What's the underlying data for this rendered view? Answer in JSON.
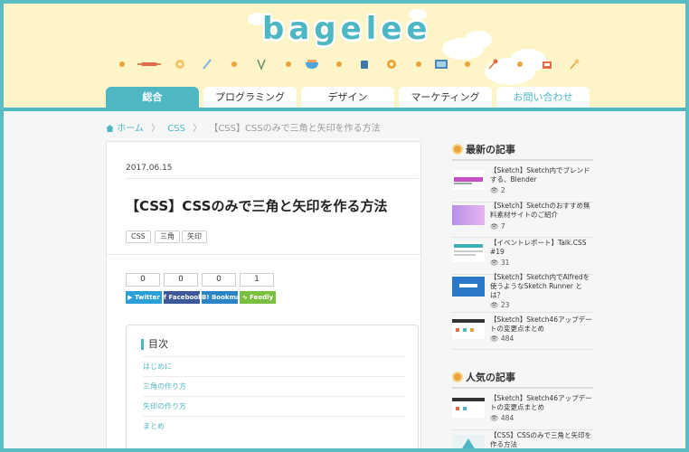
{
  "site": {
    "logo": "bagelee"
  },
  "nav": {
    "tabs": [
      {
        "label": "総合",
        "active": true
      },
      {
        "label": "プログラミング"
      },
      {
        "label": "デザイン"
      },
      {
        "label": "マーケティング"
      },
      {
        "label": "お問い合わせ"
      }
    ]
  },
  "breadcrumb": {
    "home": "ホーム",
    "category": "CSS",
    "current": "【CSS】CSSのみで三角と矢印を作る方法"
  },
  "article": {
    "date": "2017.06.15",
    "title": "【CSS】CSSのみで三角と矢印を作る方法",
    "tags": [
      "CSS",
      "三角",
      "矢印"
    ],
    "share_counts": [
      "0",
      "0",
      "0",
      "1"
    ],
    "share_buttons": [
      "Twitter",
      "Facebook",
      "Bookmar",
      "Feedly"
    ],
    "share_colors": [
      "#2b9fd8",
      "#3b5998",
      "#2b84c6",
      "#7bbf40"
    ],
    "toc": {
      "title": "目次",
      "items": [
        "はじめに",
        "三角の作り方",
        "矢印の作り方",
        "まとめ"
      ]
    }
  },
  "sidebar": {
    "latest": {
      "heading": "最新の記事",
      "posts": [
        {
          "title": "【Sketch】Sketch内でブレンドする、Blender",
          "views": "2"
        },
        {
          "title": "【Sketch】Sketchのおすすめ無料素材サイトのご紹介",
          "views": "7"
        },
        {
          "title": "【イベントレポート】Talk.CSS #19",
          "views": "31"
        },
        {
          "title": "【Sketch】Sketch内でAlfredを使うようなSketch Runner とは？",
          "views": "23"
        },
        {
          "title": "【Sketch】Sketch46アップデートの変更点まとめ",
          "views": "484"
        }
      ]
    },
    "popular": {
      "heading": "人気の記事",
      "posts": [
        {
          "title": "【Sketch】Sketch46アップデートの変更点まとめ",
          "views": "484"
        },
        {
          "title": "【CSS】CSSのみで三角と矢印を作る方法",
          "views": ""
        }
      ]
    }
  }
}
